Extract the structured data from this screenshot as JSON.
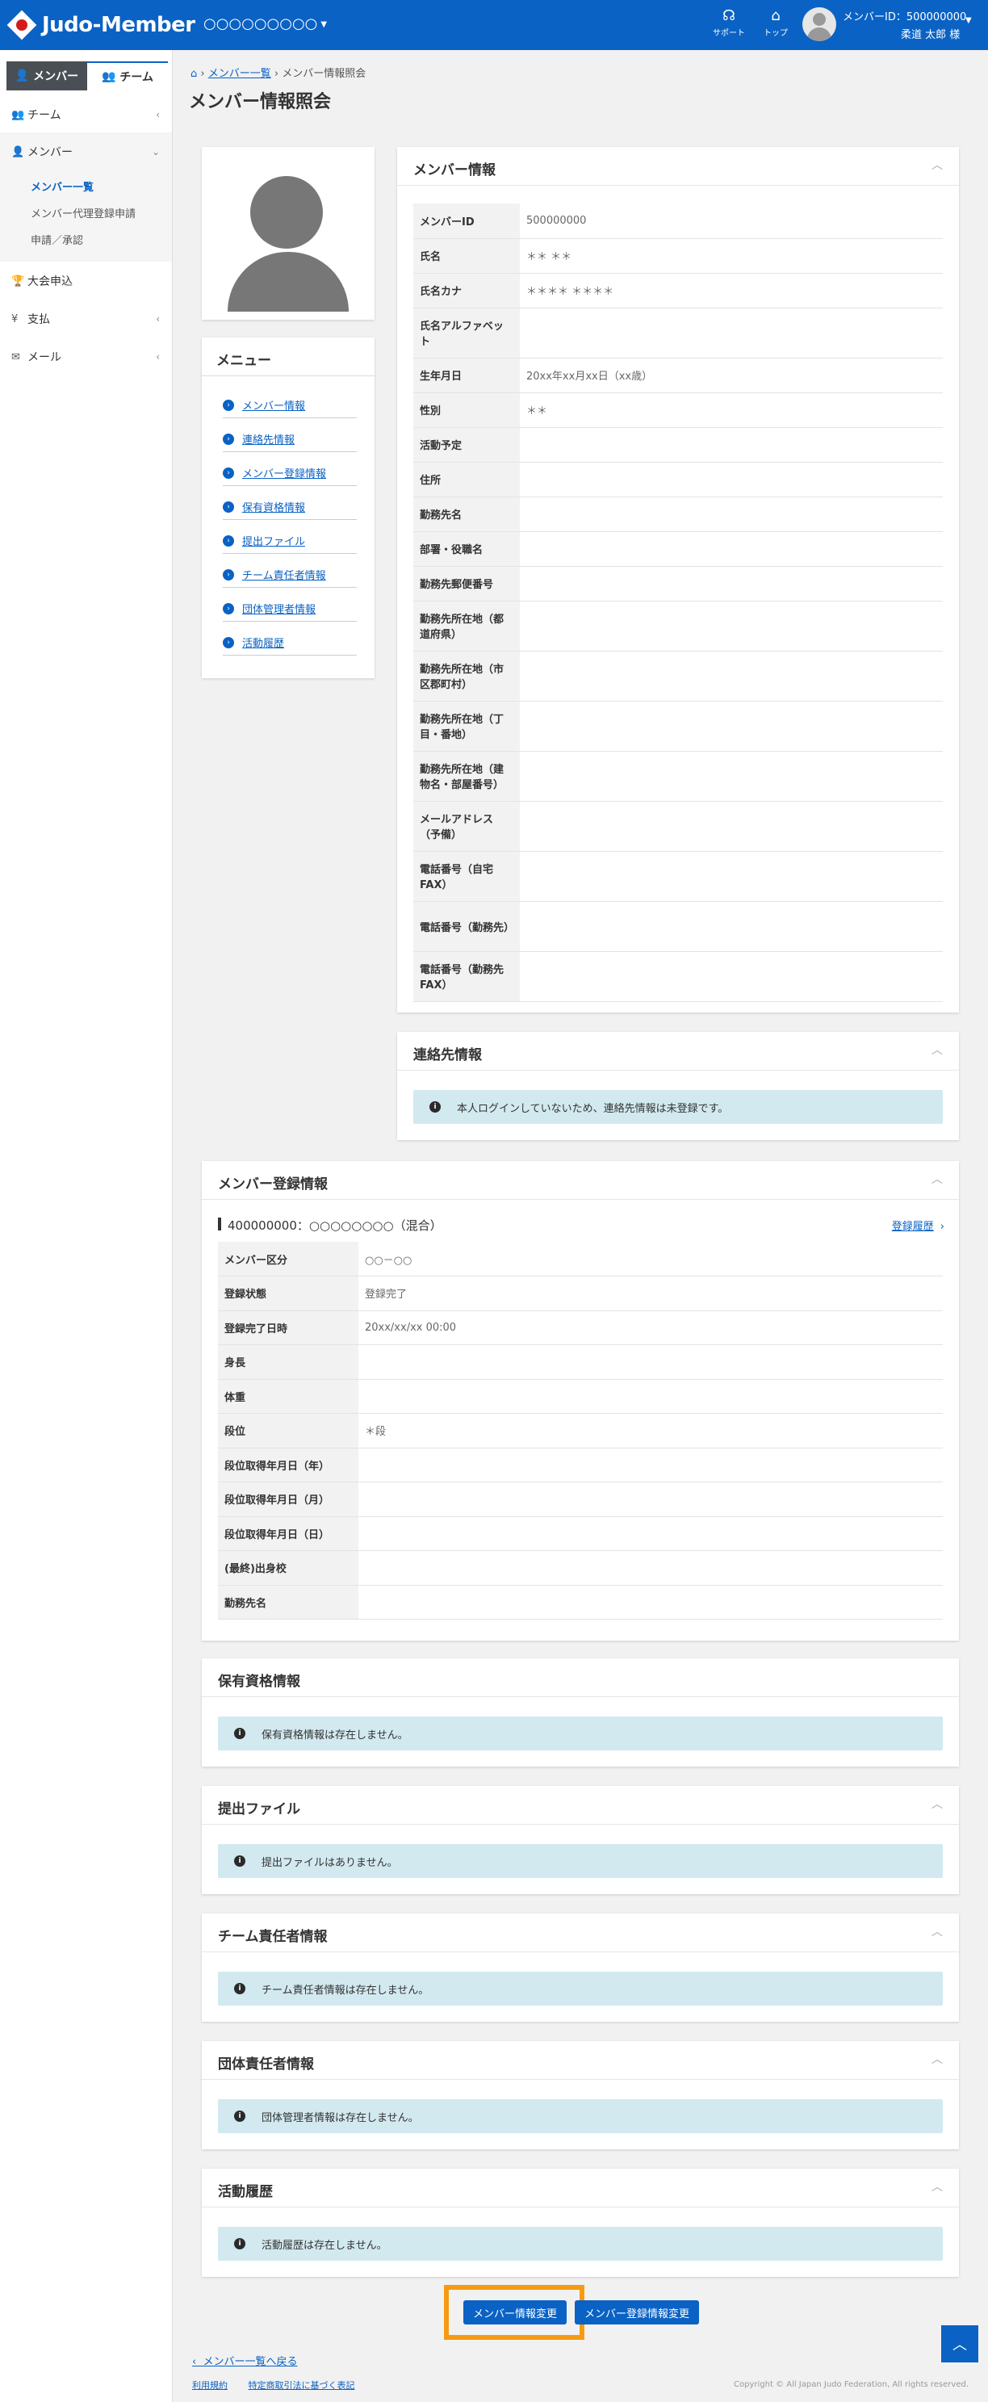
{
  "header": {
    "logo_text": "Judo-Member",
    "org_name": "○○○○○○○○○",
    "support_label": "サポート",
    "top_label": "トップ",
    "user_id": "メンバーID：500000000",
    "user_name": "柔道 太郎 様"
  },
  "sidebar": {
    "tab_member": "メンバー",
    "tab_team": "チーム",
    "items": [
      {
        "label": "チーム"
      },
      {
        "label": "メンバー"
      },
      {
        "label": "大会申込"
      },
      {
        "label": "支払"
      },
      {
        "label": "メール"
      }
    ],
    "sub_items": [
      {
        "label": "メンバー一覧"
      },
      {
        "label": "メンバー代理登録申請"
      },
      {
        "label": "申請／承認"
      }
    ]
  },
  "breadcrumb": {
    "link": "メンバー一覧",
    "current": "メンバー情報照会"
  },
  "page_title": "メンバー情報照会",
  "menu": {
    "title": "メニュー",
    "items": [
      {
        "label": "メンバー情報"
      },
      {
        "label": "連絡先情報"
      },
      {
        "label": "メンバー登録情報"
      },
      {
        "label": "保有資格情報"
      },
      {
        "label": "提出ファイル"
      },
      {
        "label": "チーム責任者情報"
      },
      {
        "label": "団体管理者情報"
      },
      {
        "label": "活動履歴"
      }
    ]
  },
  "member_info": {
    "title": "メンバー情報",
    "rows": [
      {
        "k": "メンバーID",
        "v": "500000000"
      },
      {
        "k": "氏名",
        "v": "＊＊ ＊＊"
      },
      {
        "k": "氏名カナ",
        "v": "＊＊＊＊ ＊＊＊＊"
      },
      {
        "k": "氏名アルファベット",
        "v": ""
      },
      {
        "k": "生年月日",
        "v": "20xx年xx月xx日（xx歳）"
      },
      {
        "k": "性別",
        "v": "＊＊"
      },
      {
        "k": "活動予定",
        "v": ""
      },
      {
        "k": "住所",
        "v": ""
      },
      {
        "k": "勤務先名",
        "v": ""
      },
      {
        "k": "部署・役職名",
        "v": ""
      },
      {
        "k": "勤務先郵便番号",
        "v": ""
      },
      {
        "k": "勤務先所在地（都道府県）",
        "v": ""
      },
      {
        "k": "勤務先所在地（市区郡町村）",
        "v": ""
      },
      {
        "k": "勤務先所在地（丁目・番地）",
        "v": ""
      },
      {
        "k": "勤務先所在地（建物名・部屋番号）",
        "v": ""
      },
      {
        "k": "メールアドレス（予備）",
        "v": ""
      },
      {
        "k": "電話番号（自宅FAX）",
        "v": ""
      },
      {
        "k": "電話番号（勤務先）",
        "v": ""
      },
      {
        "k": "電話番号（勤務先FAX）",
        "v": ""
      }
    ]
  },
  "contact_info": {
    "title": "連絡先情報",
    "message": "本人ログインしていないため、連絡先情報は未登録です。"
  },
  "registration_info": {
    "title": "メンバー登録情報",
    "headline": "400000000：○○○○○○○○（混合）",
    "history_link": "登録履歴",
    "rows": [
      {
        "k": "メンバー区分",
        "v": "○○－○○"
      },
      {
        "k": "登録状態",
        "v": "登録完了"
      },
      {
        "k": "登録完了日時",
        "v": "20xx/xx/xx 00:00"
      },
      {
        "k": "身長",
        "v": ""
      },
      {
        "k": "体重",
        "v": ""
      },
      {
        "k": "段位",
        "v": "＊段"
      },
      {
        "k": "段位取得年月日（年）",
        "v": ""
      },
      {
        "k": "段位取得年月日（月）",
        "v": ""
      },
      {
        "k": "段位取得年月日（日）",
        "v": ""
      },
      {
        "k": "(最終)出身校",
        "v": ""
      },
      {
        "k": "勤務先名",
        "v": ""
      }
    ]
  },
  "qualifications": {
    "title": "保有資格情報",
    "message": "保有資格情報は存在しません。"
  },
  "files": {
    "title": "提出ファイル",
    "message": "提出ファイルはありません。"
  },
  "team_leader": {
    "title": "チーム責任者情報",
    "message": "チーム責任者情報は存在しません。"
  },
  "org_manager": {
    "title": "団体責任者情報",
    "message": "団体管理者情報は存在しません。"
  },
  "activity": {
    "title": "活動履歴",
    "message": "活動履歴は存在しません。"
  },
  "buttons": {
    "edit_member": "メンバー情報変更",
    "edit_registration": "メンバー登録情報変更"
  },
  "footer": {
    "back_link": "メンバー一覧へ戻る",
    "terms": "利用規約",
    "law": "特定商取引法に基づく表記",
    "copyright": "Copyright © All Japan Judo Federation, All rights reserved."
  },
  "colors": {
    "brand": "#0a62c4",
    "highlight": "#f59b12",
    "alert_bg": "#d2e9ef"
  }
}
